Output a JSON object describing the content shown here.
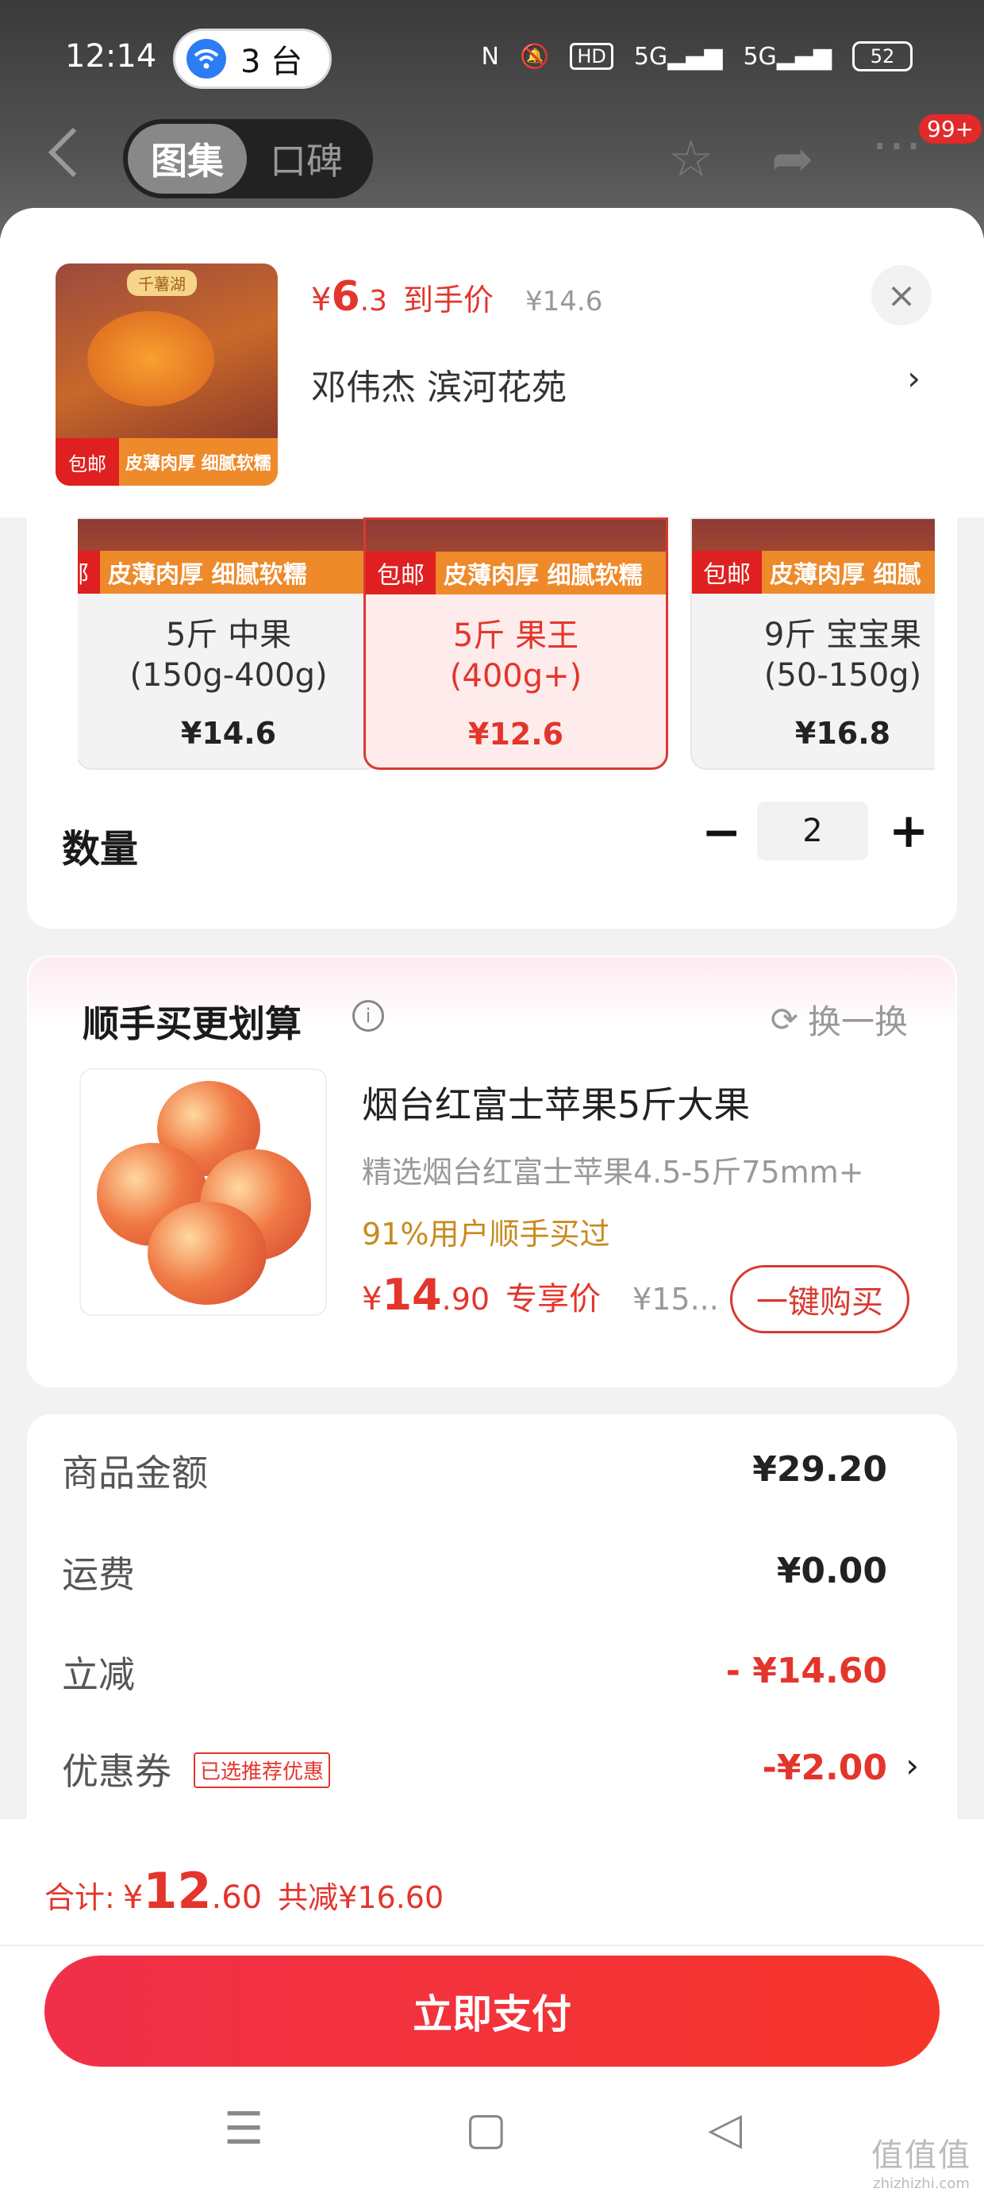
{
  "status_bar": {
    "time": "12:14",
    "hotspot_count": "3 台",
    "hd_label": "HD",
    "net1": "5G",
    "net2": "5G",
    "battery": "52"
  },
  "topnav": {
    "tab_active": "图集",
    "tab_inactive": "口碑",
    "badge": "99+"
  },
  "sheet": {
    "thumb_tag": "千薯湖",
    "thumb_baoyou": "包邮",
    "thumb_strip": "皮薄肉厚 细腻软糯",
    "price_currency": "¥",
    "price_int": "6",
    "price_dec": ".3",
    "price_label": "到手价",
    "orig_price": "¥14.6",
    "address": "邓伟杰  滨河花苑",
    "address_chevron": "›",
    "close": "×"
  },
  "options": [
    {
      "badge": "包邮",
      "strip": "皮薄肉厚 细腻软糯",
      "name": "5斤 中果",
      "sub": "(150g-400g)",
      "price": "¥14.6",
      "selected": false
    },
    {
      "badge": "包邮",
      "strip": "皮薄肉厚 细腻软糯",
      "name": "5斤 果王",
      "sub": "(400g+)",
      "price": "¥12.6",
      "selected": true
    },
    {
      "badge": "包邮",
      "strip": "皮薄肉厚 细腻",
      "name": "9斤 宝宝果",
      "sub": "(50-150g)",
      "price": "¥16.8",
      "selected": false
    }
  ],
  "quantity": {
    "label": "数量",
    "minus": "−",
    "value": "2",
    "plus": "+"
  },
  "upsell": {
    "title": "顺手买更划算",
    "info": "i",
    "swap": "换一换",
    "product_name": "烟台红富士苹果5斤大果",
    "product_desc": "精选烟台红富士苹果4.5-5斤75mm+",
    "stat": "91%用户顺手买过",
    "price_currency": "¥",
    "price_int": "14",
    "price_dec": ".90",
    "price_label": "专享价",
    "orig_price": "¥15...",
    "buy_button": "一键购买"
  },
  "fees": [
    {
      "label": "商品金额",
      "value": "¥29.20",
      "negative": false
    },
    {
      "label": "运费",
      "value": "¥0.00",
      "negative": false
    },
    {
      "label": "立减",
      "value": "- ¥14.60",
      "negative": true
    },
    {
      "label": "优惠券",
      "value": "-¥2.00",
      "negative": true,
      "tag": "已选推荐优惠",
      "chevron": "›"
    }
  ],
  "footer": {
    "total_label": "合计:",
    "total_currency": "¥",
    "total_int": "12",
    "total_dec": ".60",
    "total_saved": "共减¥16.60",
    "pay_button": "立即支付"
  },
  "watermark": {
    "main": "值值值",
    "sub": "zhizhizhi.com"
  },
  "colors": {
    "accent": "#e4352c",
    "stat": "#c98a1e"
  }
}
